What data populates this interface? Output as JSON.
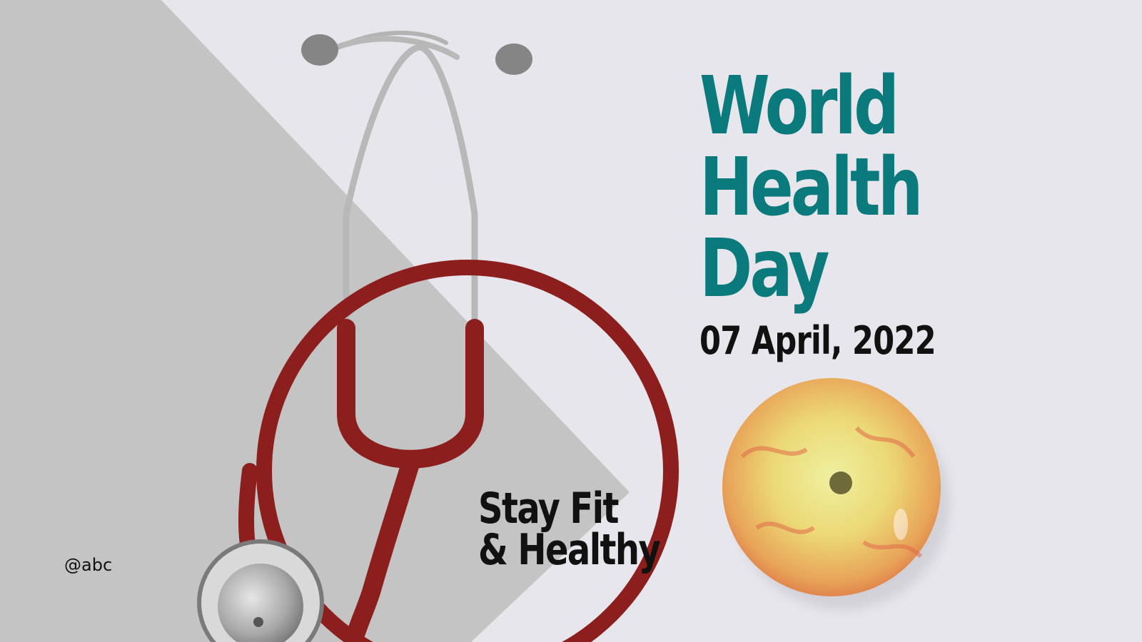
{
  "poster": {
    "title_lines": [
      "World",
      "Health",
      "Day"
    ],
    "date": "07 April, 2022",
    "slogan_lines": [
      "Stay Fit",
      "& Healthy"
    ],
    "handle": "@abc"
  },
  "colors": {
    "background": "#e7e6ec",
    "panel": "#c3c4c3",
    "title": "#0b7a7d",
    "text": "#111111",
    "tubing": "#8c1f1d",
    "metal": "#b8b8b8",
    "apple_yellow": "#e9d66b",
    "apple_red": "#e0673f"
  },
  "icons": {
    "stethoscope": "stethoscope-icon",
    "apple": "apple-icon"
  }
}
